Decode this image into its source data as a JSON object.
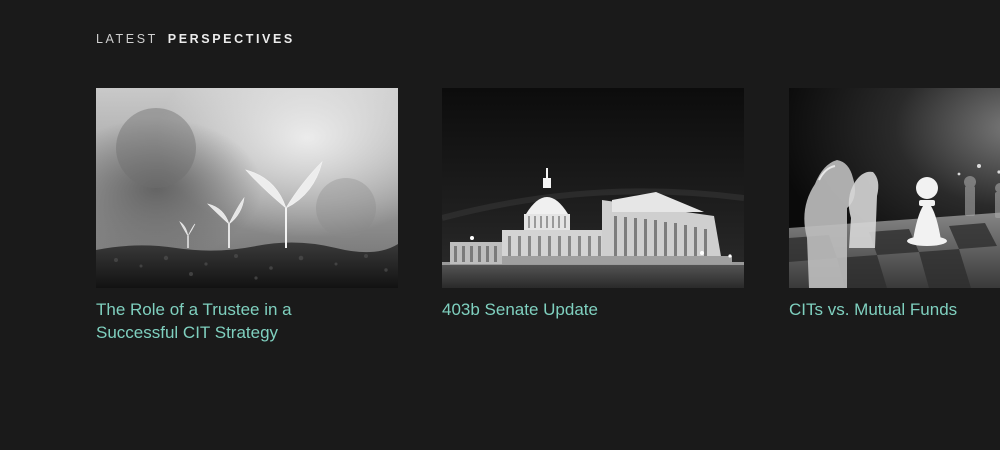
{
  "section": {
    "heading_light": "LATEST",
    "heading_bold": "PERSPECTIVES"
  },
  "cards": [
    {
      "title": "The Role of a Trustee in a Successful CIT Strategy",
      "image_subject": "seedlings-sprouting-from-soil"
    },
    {
      "title": "403b Senate Update",
      "image_subject": "us-capitol-building-at-night"
    },
    {
      "title": "CITs vs. Mutual Funds",
      "image_subject": "chess-pieces-on-board"
    }
  ],
  "colors": {
    "background": "#1a1a1a",
    "link": "#7fd0bf",
    "heading": "#e0e0e0"
  }
}
